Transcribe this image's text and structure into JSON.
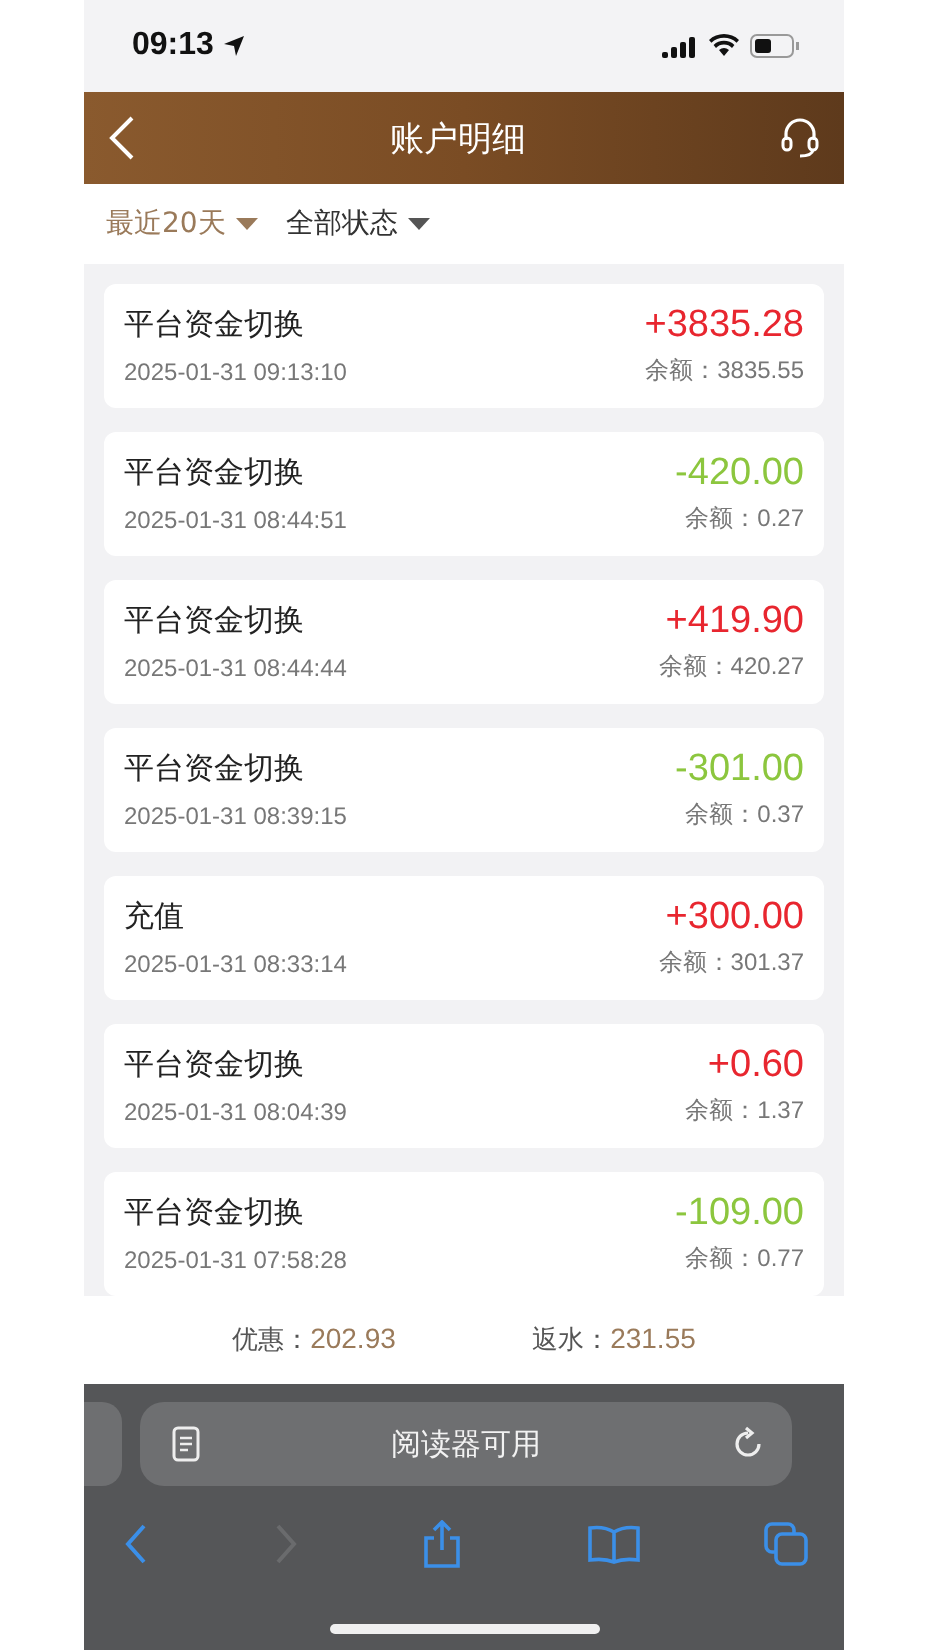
{
  "status_bar": {
    "time": "09:13"
  },
  "header": {
    "title": "账户明细"
  },
  "filters": [
    {
      "label": "最近20天",
      "selected": true
    },
    {
      "label": "全部状态",
      "selected": false
    }
  ],
  "records": [
    {
      "title": "平台资金切换",
      "time": "2025-01-31 09:13:10",
      "amount": "+3835.28",
      "balance": "余额：3835.55",
      "kind": "credit"
    },
    {
      "title": "平台资金切换",
      "time": "2025-01-31 08:44:51",
      "amount": "-420.00",
      "balance": "余额：0.27",
      "kind": "debit"
    },
    {
      "title": "平台资金切换",
      "time": "2025-01-31 08:44:44",
      "amount": "+419.90",
      "balance": "余额：420.27",
      "kind": "credit"
    },
    {
      "title": "平台资金切换",
      "time": "2025-01-31 08:39:15",
      "amount": "-301.00",
      "balance": "余额：0.37",
      "kind": "debit"
    },
    {
      "title": "充值",
      "time": "2025-01-31 08:33:14",
      "amount": "+300.00",
      "balance": "余额：301.37",
      "kind": "credit"
    },
    {
      "title": "平台资金切换",
      "time": "2025-01-31 08:04:39",
      "amount": "+0.60",
      "balance": "余额：1.37",
      "kind": "credit"
    },
    {
      "title": "平台资金切换",
      "time": "2025-01-31 07:58:28",
      "amount": "-109.00",
      "balance": "余额：0.77",
      "kind": "debit"
    }
  ],
  "summary": [
    {
      "label": "优惠：",
      "value": "202.93"
    },
    {
      "label": "返水：",
      "value": "231.55"
    }
  ],
  "browser": {
    "address": "阅读器可用",
    "forward_disabled": true
  }
}
